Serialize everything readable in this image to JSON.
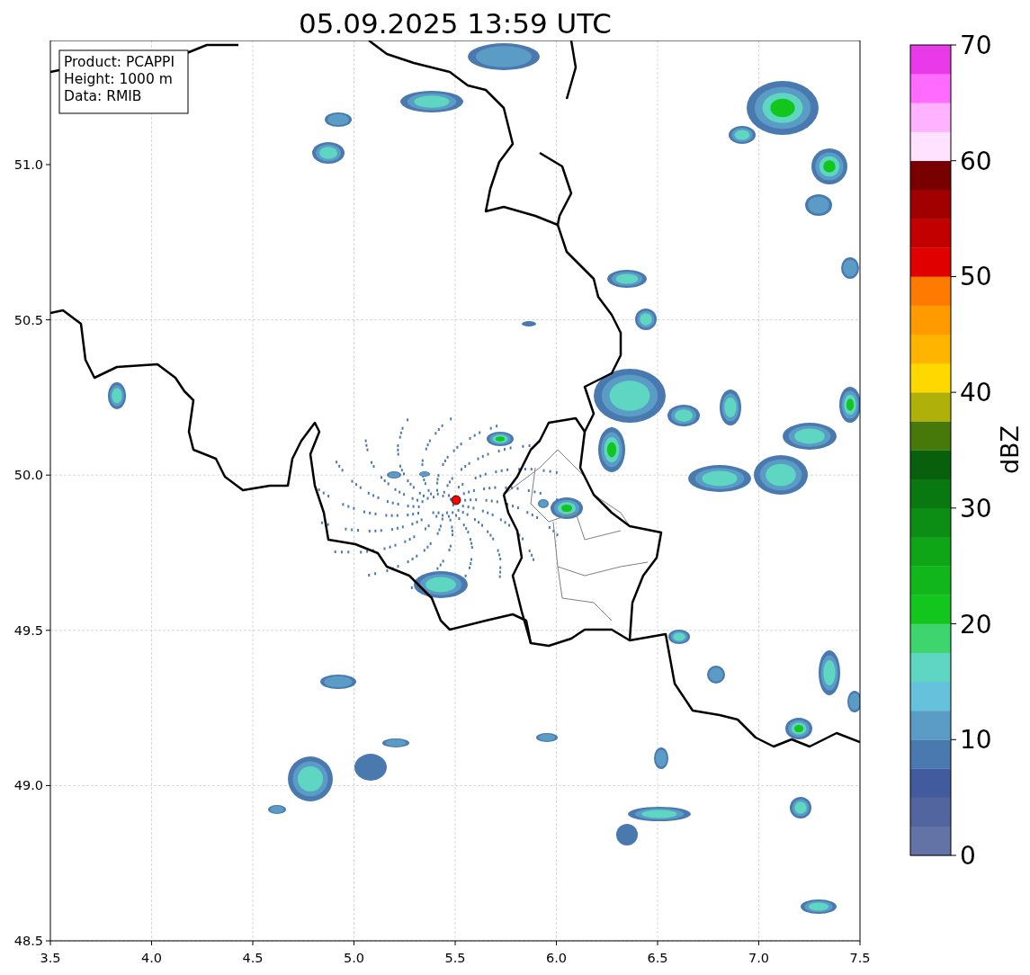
{
  "title": "05.09.2025 13:59 UTC",
  "map": {
    "info": [
      "Product: PCAPPI",
      "Height: 1000 m",
      "Data: RMIB"
    ],
    "xticks": [
      "3.5",
      "4.0",
      "4.5",
      "5.0",
      "5.5",
      "6.0",
      "6.5",
      "7.0",
      "7.5"
    ],
    "yticks": [
      "51.0",
      "50.5",
      "50.0",
      "49.5",
      "49.0",
      "48.5"
    ]
  },
  "colorbar": {
    "label": "dBZ",
    "ticks": [
      "70",
      "60",
      "50",
      "40",
      "30",
      "20",
      "10",
      "0"
    ],
    "bands": [
      {
        "color": "#6473a6"
      },
      {
        "color": "#53659f"
      },
      {
        "color": "#425b9f"
      },
      {
        "color": "#4a79b0"
      },
      {
        "color": "#5a9cc6"
      },
      {
        "color": "#66c2dc"
      },
      {
        "color": "#5ed6c2"
      },
      {
        "color": "#3ed56e"
      },
      {
        "color": "#12c61e"
      },
      {
        "color": "#10b61a"
      },
      {
        "color": "#0ea516"
      },
      {
        "color": "#0c8d14"
      },
      {
        "color": "#0a7811"
      },
      {
        "color": "#085f0c"
      },
      {
        "color": "#46780a"
      },
      {
        "color": "#b0b00a"
      },
      {
        "color": "#ffd800"
      },
      {
        "color": "#ffb400"
      },
      {
        "color": "#ff9a00"
      },
      {
        "color": "#ff7a00"
      },
      {
        "color": "#e00000"
      },
      {
        "color": "#c20000"
      },
      {
        "color": "#a00000"
      },
      {
        "color": "#780000"
      },
      {
        "color": "#ffe2ff"
      },
      {
        "color": "#ffb2ff"
      },
      {
        "color": "#ff6aff"
      },
      {
        "color": "#e83ae8"
      }
    ]
  }
}
